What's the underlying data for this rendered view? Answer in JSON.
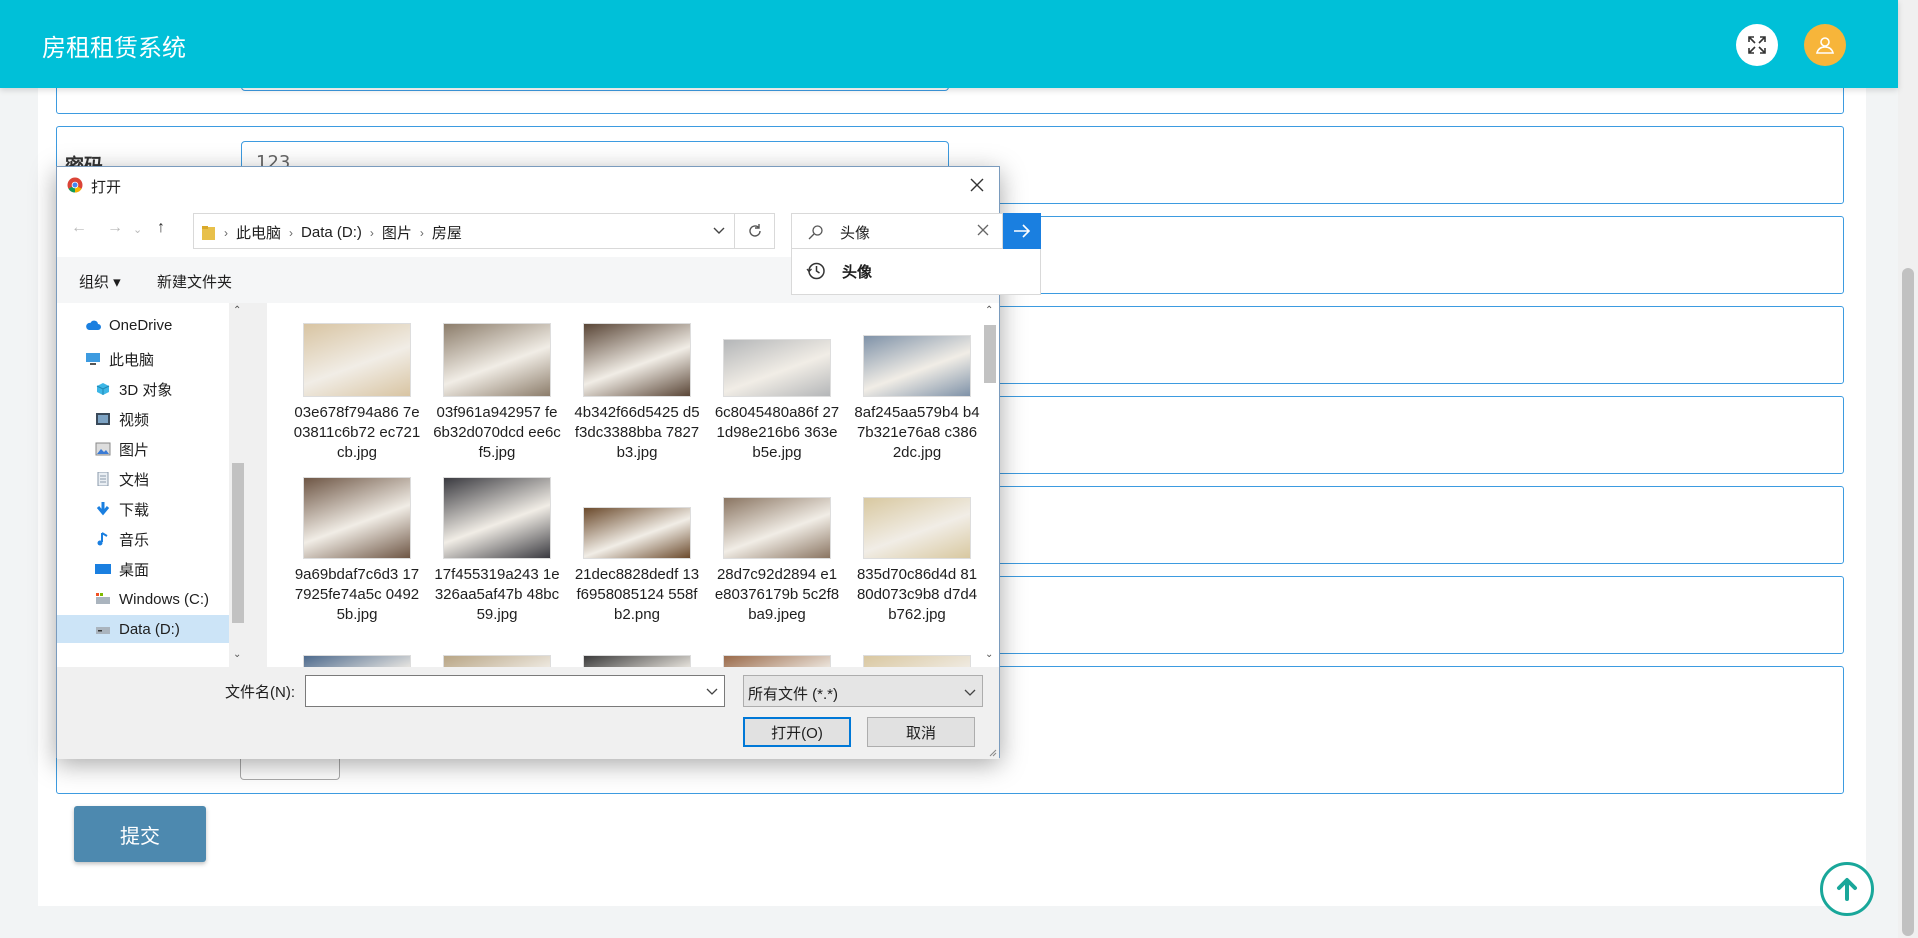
{
  "app": {
    "title": "房租租赁系统"
  },
  "form": {
    "password_label": "密码",
    "password_value": "123",
    "submit_label": "提交"
  },
  "dialog": {
    "title": "打开",
    "breadcrumbs": [
      "此电脑",
      "Data (D:)",
      "图片",
      "房屋"
    ],
    "search_value": "头像",
    "search_history": [
      "头像"
    ],
    "toolbar": {
      "organize": "组织 ▾",
      "new_folder": "新建文件夹"
    },
    "nav": [
      {
        "label": "OneDrive",
        "icon": "cloud-icon"
      },
      {
        "label": "此电脑",
        "icon": "computer-icon"
      },
      {
        "label": "3D 对象",
        "icon": "cube-icon"
      },
      {
        "label": "视频",
        "icon": "video-icon"
      },
      {
        "label": "图片",
        "icon": "pictures-icon"
      },
      {
        "label": "文档",
        "icon": "document-icon"
      },
      {
        "label": "下载",
        "icon": "download-icon"
      },
      {
        "label": "音乐",
        "icon": "music-icon"
      },
      {
        "label": "桌面",
        "icon": "desktop-icon"
      },
      {
        "label": "Windows (C:)",
        "icon": "drive-icon"
      },
      {
        "label": "Data (D:)",
        "icon": "drive-icon"
      }
    ],
    "files": [
      {
        "name": "03e678f794a86 7e03811c6b72 ec721cb.jpg",
        "color": "#d8c4a2"
      },
      {
        "name": "03f961a942957 fe6b32d070dcd ee6cf5.jpg",
        "color": "#8c7d6b"
      },
      {
        "name": "4b342f66d5425 d5f3dc3388bba 7827b3.jpg",
        "color": "#5a4637"
      },
      {
        "name": "6c8045480a86f 271d98e216b6 363eb5e.jpg",
        "color": "#b4b6b8"
      },
      {
        "name": "8af245aa579b4 b47b321e76a8 c3862dc.jpg",
        "color": "#7f92a8"
      },
      {
        "name": "9a69bdaf7c6d3 177925fe74a5c 04925b.jpg",
        "color": "#6e5645"
      },
      {
        "name": "17f455319a243 1e326aa5af47b 48bc59.jpg",
        "color": "#3a3a40"
      },
      {
        "name": "21dec8828dedf 13f6958085124 558fb2.png",
        "color": "#6b4a2c"
      },
      {
        "name": "28d7c92d2894 e1e80376179b 5c2f8ba9.jpeg",
        "color": "#8a7562"
      },
      {
        "name": "835d70c86d4d 8180d073c9b8 d7d4b762.jpg",
        "color": "#d8c8a0"
      },
      {
        "name": "",
        "color": "#4d6a8d"
      },
      {
        "name": "",
        "color": "#b8a585"
      },
      {
        "name": "",
        "color": "#3b3b3b"
      },
      {
        "name": "",
        "color": "#9a6a4a"
      },
      {
        "name": "",
        "color": "#d9c7a0"
      }
    ],
    "filename_label": "文件名(N):",
    "filename_value": "",
    "file_type": "所有文件 (*.*)",
    "open_label": "打开(O)",
    "cancel_label": "取消"
  },
  "colors": {
    "header": "#00c0d8",
    "accent_border": "#3d9be0",
    "submit": "#4d89af",
    "primary_dialog": "#1a7fe0"
  }
}
